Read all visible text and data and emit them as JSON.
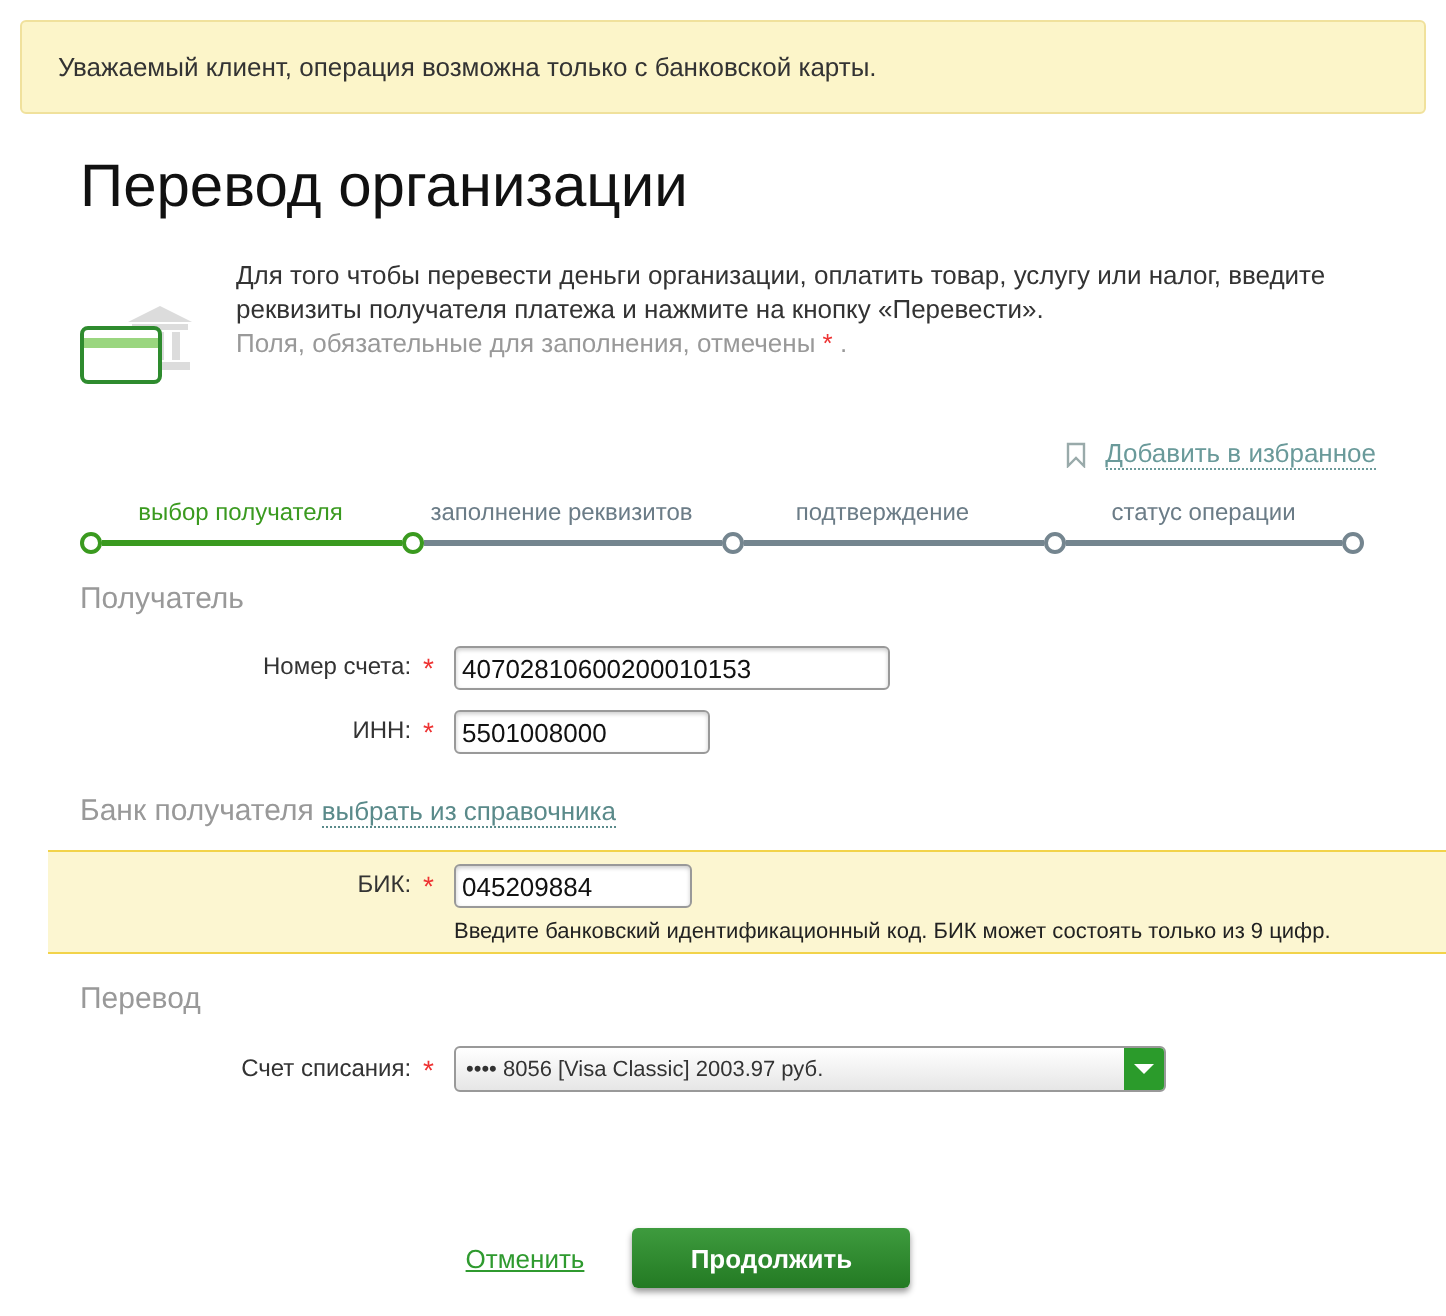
{
  "alert": "Уважаемый клиент, операция возможна только с банковской карты.",
  "title": "Перевод организации",
  "intro": {
    "text": "Для того чтобы перевести деньги организации, оплатить товар, услугу или налог, введите реквизиты получателя платежа и нажмите на кнопку «Перевести».",
    "note": "Поля, обязательные для заполнения, отмечены",
    "note_mark": "*",
    "note_end": "."
  },
  "favorite_link": "Добавить в избранное",
  "steps": [
    {
      "label": "выбор получателя",
      "selected": true
    },
    {
      "label": "заполнение реквизитов",
      "selected": false
    },
    {
      "label": "подтверждение",
      "selected": false
    },
    {
      "label": "статус операции",
      "selected": false
    }
  ],
  "sections": [
    {
      "title": "Получатель",
      "fields": [
        {
          "kind": "input",
          "label": "Номер счета:",
          "required": true,
          "value": "40702810600200010153",
          "highlighted": false
        },
        {
          "kind": "input",
          "label": "ИНН:",
          "required": true,
          "value": "5501008000",
          "highlighted": false
        }
      ]
    },
    {
      "title": "Банк получателя",
      "link": "выбрать из справочника",
      "fields": [
        {
          "kind": "input",
          "label": "БИК:",
          "required": true,
          "value": "045209884",
          "highlighted": true,
          "hint": "Введите банковский идентификационный код. БИК может состоять только из 9 цифр."
        }
      ]
    },
    {
      "title": "Перевод",
      "fields": [
        {
          "kind": "select",
          "label": "Счет списания:",
          "required": true,
          "value": "•••• 8056 [Visa Classic] 2003.97 руб.",
          "highlighted": false
        }
      ]
    }
  ],
  "required_mark": "*",
  "buttons": {
    "cancel": "Отменить",
    "submit": "Продолжить"
  }
}
